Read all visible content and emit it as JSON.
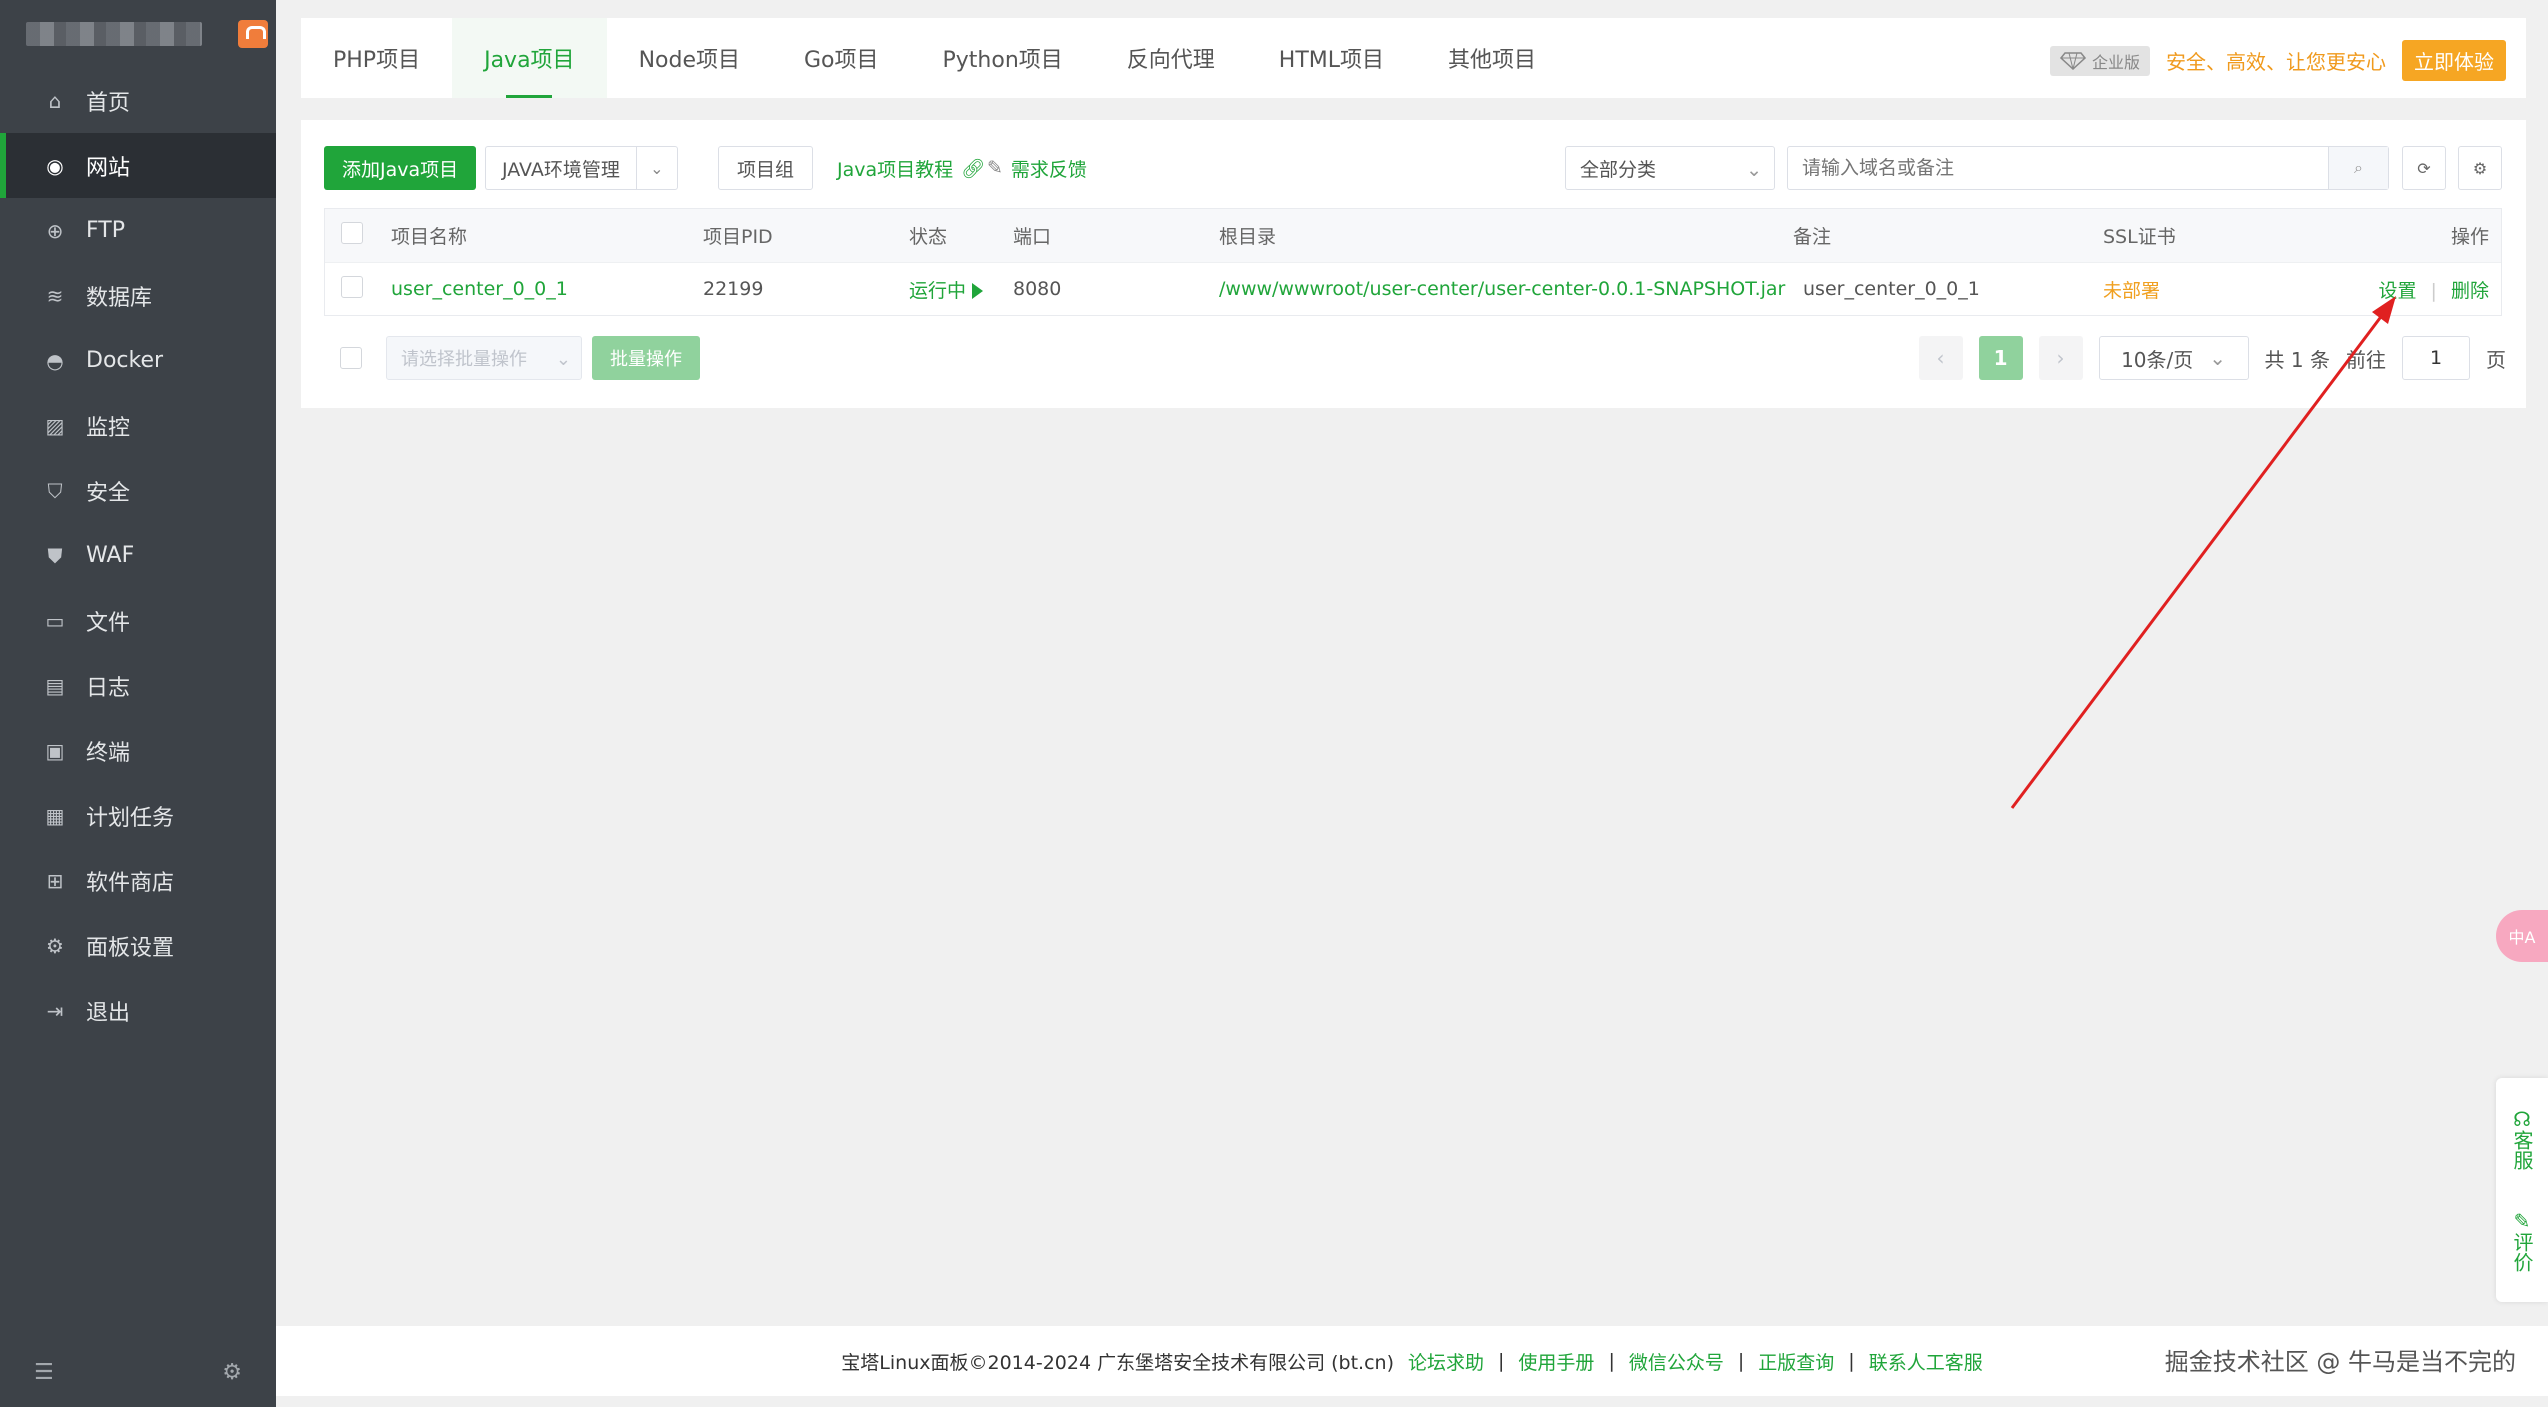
{
  "sidebar": {
    "items": [
      {
        "label": "首页",
        "icon": "home-icon",
        "glyph": "⌂"
      },
      {
        "label": "网站",
        "icon": "globe-icon",
        "glyph": "◉",
        "active": true
      },
      {
        "label": "FTP",
        "icon": "ftp-globe-icon",
        "glyph": "⊕"
      },
      {
        "label": "数据库",
        "icon": "database-icon",
        "glyph": "≋"
      },
      {
        "label": "Docker",
        "icon": "docker-icon",
        "glyph": "◓"
      },
      {
        "label": "监控",
        "icon": "monitor-icon",
        "glyph": "▨"
      },
      {
        "label": "安全",
        "icon": "shield-icon",
        "glyph": "⛉"
      },
      {
        "label": "WAF",
        "icon": "waf-shield-icon",
        "glyph": "⛊"
      },
      {
        "label": "文件",
        "icon": "folder-icon",
        "glyph": "▭"
      },
      {
        "label": "日志",
        "icon": "log-icon",
        "glyph": "▤"
      },
      {
        "label": "终端",
        "icon": "terminal-icon",
        "glyph": "▣"
      },
      {
        "label": "计划任务",
        "icon": "calendar-icon",
        "glyph": "▦"
      },
      {
        "label": "软件商店",
        "icon": "apps-icon",
        "glyph": "⊞"
      },
      {
        "label": "面板设置",
        "icon": "gear-icon",
        "glyph": "⚙"
      },
      {
        "label": "退出",
        "icon": "logout-icon",
        "glyph": "⇥"
      }
    ]
  },
  "tabs": [
    "PHP项目",
    "Java项目",
    "Node项目",
    "Go项目",
    "Python项目",
    "反向代理",
    "HTML项目",
    "其他项目"
  ],
  "promo": {
    "edition": "企业版",
    "slogan": "安全、高效、让您更安心",
    "cta": "立即体验"
  },
  "toolbar": {
    "add_label": "添加Java项目",
    "env_label": "JAVA环境管理",
    "group_label": "项目组",
    "tutorial_label": "Java项目教程",
    "feedback_label": "需求反馈",
    "category_value": "全部分类",
    "search_placeholder": "请输入域名或备注"
  },
  "table": {
    "headers": [
      "项目名称",
      "项目PID",
      "状态",
      "端口",
      "根目录",
      "备注",
      "SSL证书",
      "操作"
    ],
    "rows": [
      {
        "name": "user_center_0_0_1",
        "pid": "22199",
        "status": "运行中",
        "port": "8080",
        "root": "/www/wwwroot/user-center/user-center-0.0.1-SNAPSHOT.jar",
        "note": "user_center_0_0_1",
        "ssl": "未部署",
        "action_settings": "设置",
        "action_delete": "删除"
      }
    ]
  },
  "bulk": {
    "placeholder": "请选择批量操作",
    "button": "批量操作"
  },
  "pager": {
    "current": "1",
    "page_size": "10条/页",
    "total": "共 1 条",
    "goto_prefix": "前往",
    "goto_value": "1",
    "goto_suffix": "页"
  },
  "footer": {
    "copyright": "宝塔Linux面板©2014-2024 广东堡塔安全技术有限公司 (bt.cn)",
    "links": [
      "论坛求助",
      "使用手册",
      "微信公众号",
      "正版查询",
      "联系人工客服"
    ]
  },
  "float": {
    "translate": "中A",
    "service": "客服",
    "review": "评价"
  },
  "watermark": "掘金技术社区 @ 牛马是当不完的",
  "colors": {
    "brand": "#20a53a",
    "sidebar": "#3d4248",
    "orange": "#f0a020",
    "arrow": "#e02020"
  }
}
